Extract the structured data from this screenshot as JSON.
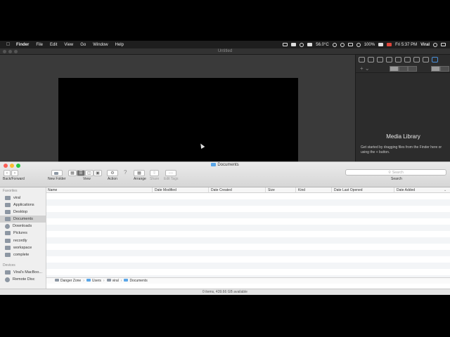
{
  "menubar": {
    "app_name": "Finder",
    "menus": [
      "File",
      "Edit",
      "View",
      "Go",
      "Window",
      "Help"
    ],
    "temperature": "56.0°C",
    "battery": "100%",
    "clock": "Fri 5:37 PM",
    "user": "Viral"
  },
  "editor": {
    "title": "Untitled"
  },
  "media_library": {
    "title": "Media Library",
    "description": "Get started by dragging files from the Finder here or using the + button."
  },
  "finder": {
    "title": "Documents",
    "toolbar": {
      "back_forward_label": "Back/Forward",
      "new_folder_label": "New Folder",
      "view_label": "View",
      "action_label": "Action",
      "arrange_label": "Arrange",
      "share_label": "Share",
      "edit_tags_label": "Edit Tags",
      "search_placeholder": "Search",
      "search_label": "Search"
    },
    "sidebar": {
      "favorites_header": "Favorites",
      "favorites": [
        "viral",
        "Applications",
        "Desktop",
        "Documents",
        "Downloads",
        "Pictures",
        "recordly",
        "workspace",
        "complete"
      ],
      "selected": "Documents",
      "devices_header": "Devices",
      "devices": [
        "Viral's MacBoo...",
        "Remote Disc"
      ]
    },
    "columns": [
      "Name",
      "Date Modified",
      "Date Created",
      "Size",
      "Kind",
      "Date Last Opened",
      "Date Added"
    ],
    "path": [
      "Danger Zone",
      "Users",
      "viral",
      "Documents"
    ],
    "status": "0 items, 439.66 GB available"
  }
}
